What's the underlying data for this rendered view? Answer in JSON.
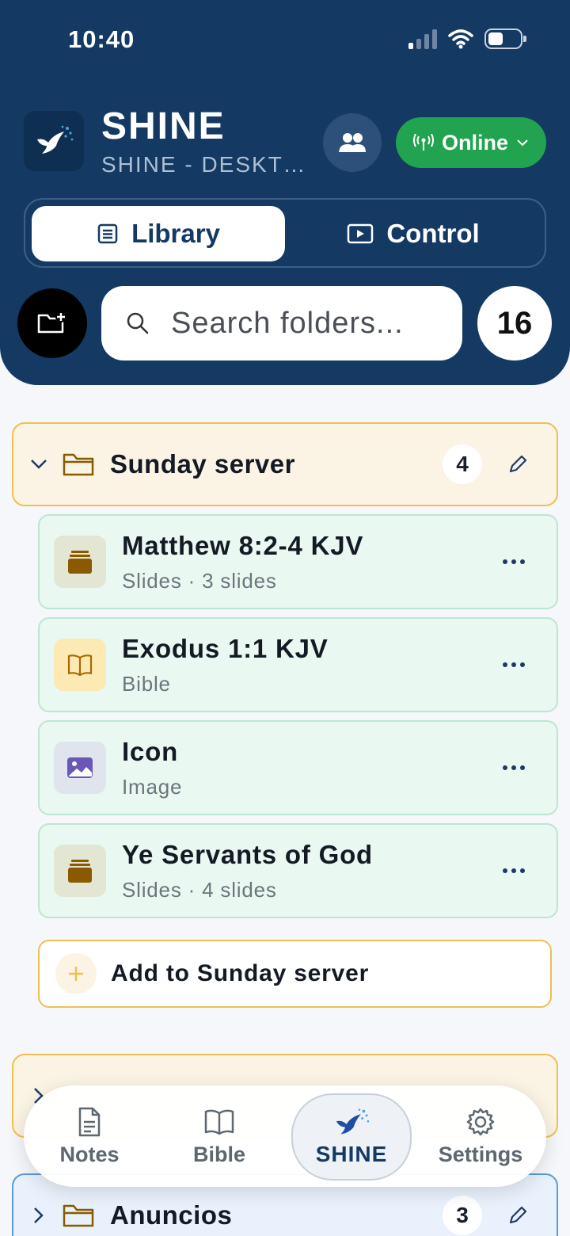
{
  "status_bar": {
    "time": "10:40"
  },
  "header": {
    "title": "SHINE",
    "subtitle": "SHINE - DESKTOP",
    "online_label": "Online",
    "tabs": [
      {
        "label": "Library",
        "active": true
      },
      {
        "label": "Control",
        "active": false
      }
    ],
    "search": {
      "placeholder": "Search folders..."
    },
    "folder_count": "16"
  },
  "folders": [
    {
      "name": "Sunday server",
      "count": "4",
      "expanded": true,
      "items": [
        {
          "title": "Matthew 8:2-4 KJV",
          "subtitle": "Slides · 3 slides",
          "type": "slides"
        },
        {
          "title": "Exodus 1:1 KJV",
          "subtitle": "Bible",
          "type": "bible"
        },
        {
          "title": "Icon",
          "subtitle": "Image",
          "type": "image"
        },
        {
          "title": "Ye Servants of God",
          "subtitle": "Slides · 4 slides",
          "type": "slides"
        }
      ],
      "add_label": "Add to Sunday server"
    },
    {
      "name": "Anuncios",
      "count": "3",
      "expanded": false
    }
  ],
  "bottom_nav": [
    {
      "label": "Notes",
      "icon": "notes-icon"
    },
    {
      "label": "Bible",
      "icon": "book-icon"
    },
    {
      "label": "SHINE",
      "icon": "dove-icon",
      "active": true
    },
    {
      "label": "Settings",
      "icon": "gear-icon"
    }
  ],
  "colors": {
    "header_bg": "#143a63",
    "online_green": "#22a34f",
    "folder_gold": "#f0bf52",
    "item_green_bg": "#e9f8f1",
    "folder_blue": "#5b9bde"
  }
}
